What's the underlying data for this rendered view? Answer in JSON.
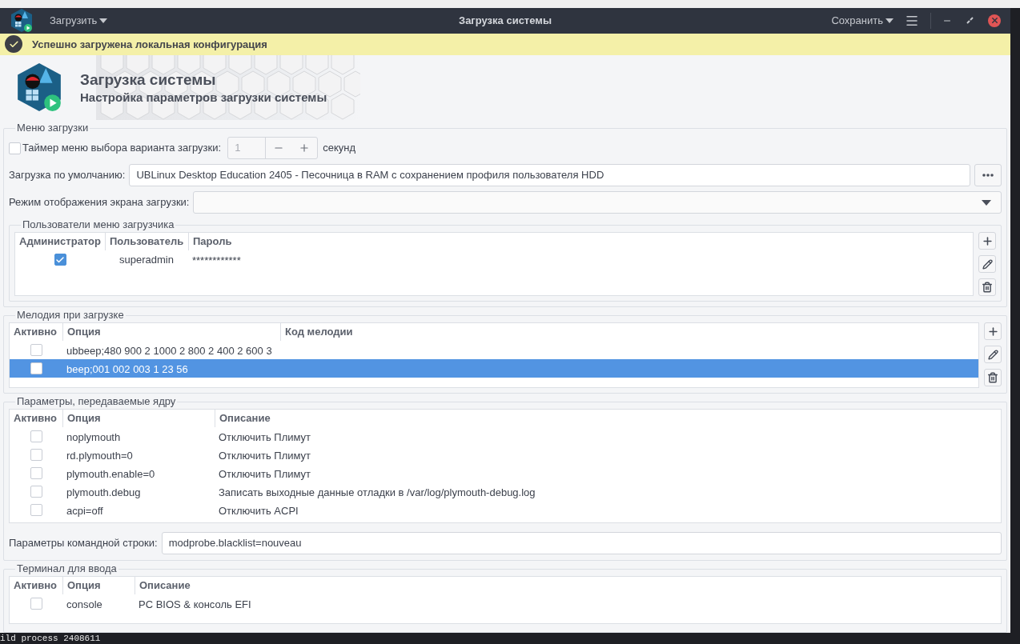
{
  "window": {
    "title": "Загрузка системы",
    "load_menu": "Загрузить",
    "save_menu": "Сохранить"
  },
  "notification": {
    "text": "Успешно загружена локальная конфигурация"
  },
  "header": {
    "title": "Загрузка системы",
    "subtitle": "Настройка параметров загрузки системы"
  },
  "boot_menu": {
    "legend": "Меню загрузки",
    "timer": {
      "checked": false,
      "label": "Таймер меню выбора варианта загрузки:",
      "value": "1",
      "disabled": true,
      "unit": "секунд"
    },
    "default": {
      "label": "Загрузка по умолчанию:",
      "value": "UBLinux Desktop Education 2405 - Песочница в RAM с сохранением профиля пользователя HDD"
    },
    "display_mode": {
      "label": "Режим отображения экрана загрузки:"
    }
  },
  "users": {
    "legend": "Пользователи меню загрузчика",
    "columns": [
      "Администратор",
      "Пользователь",
      "Пароль"
    ],
    "rows": [
      {
        "admin": true,
        "user": "superadmin",
        "password": "************"
      }
    ]
  },
  "melody": {
    "legend": "Мелодия при загрузке",
    "columns": [
      "Активно",
      "Опция",
      "Код мелодии"
    ],
    "rows": [
      {
        "active": false,
        "option": "ubbeep;480 900 2 1000 2 800 2 400 2 600 3",
        "selected": false
      },
      {
        "active": false,
        "option": "beep;001 002 003 1 23 56",
        "selected": true
      }
    ]
  },
  "kernel": {
    "legend": "Параметры, передаваемые ядру",
    "columns": [
      "Активно",
      "Опция",
      "Описание"
    ],
    "rows": [
      {
        "active": false,
        "option": "noplymouth",
        "description": "Отключить Плимут"
      },
      {
        "active": false,
        "option": "rd.plymouth=0",
        "description": "Отключить Плимут"
      },
      {
        "active": false,
        "option": "plymouth.enable=0",
        "description": "Отключить Плимут"
      },
      {
        "active": false,
        "option": "plymouth.debug",
        "description": "Записать выходные данные отладки в /var/log/plymouth-debug.log"
      },
      {
        "active": false,
        "option": "acpi=off",
        "description": "Отключить ACPI"
      }
    ],
    "cmdline": {
      "label": "Параметры командной строки:",
      "value": "modprobe.blacklist=nouveau"
    }
  },
  "terminal": {
    "legend": "Терминал для ввода",
    "columns": [
      "Активно",
      "Опция",
      "Описание"
    ],
    "rows": [
      {
        "active": false,
        "option": "console",
        "description": "PC BIOS & консоль EFI"
      }
    ]
  },
  "background_terminal": {
    "text": "ild process 2408611"
  }
}
